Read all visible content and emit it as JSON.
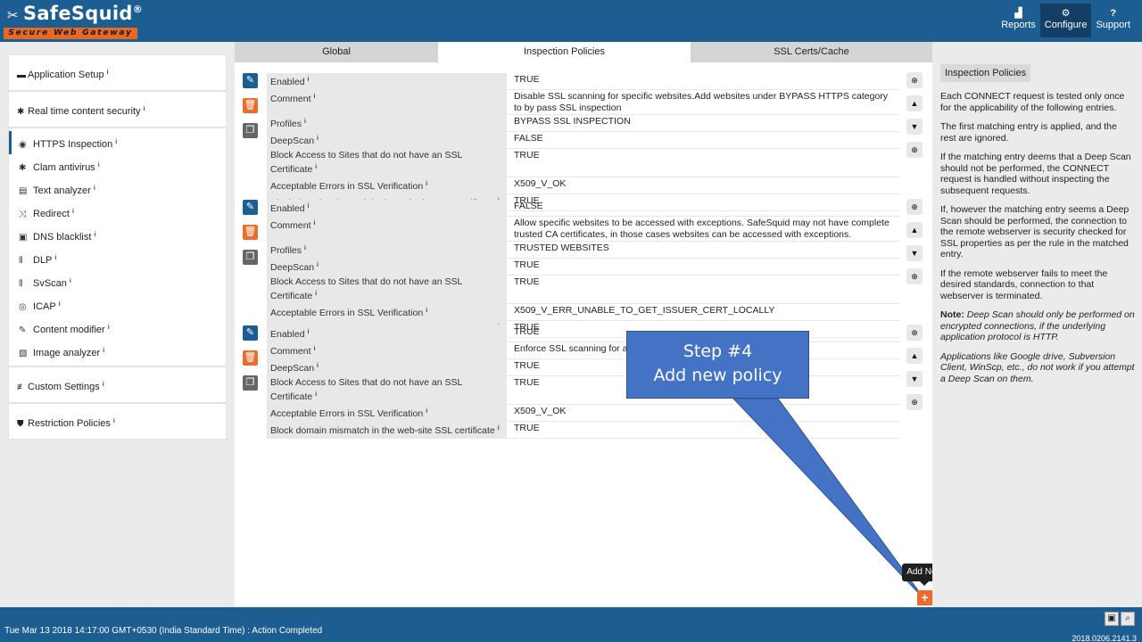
{
  "header": {
    "logo_text": "SafeSquid",
    "logo_reg": "®",
    "logo_sub": "Secure Web Gateway",
    "nav": [
      {
        "label": "Reports",
        "icon": "bar-chart-icon"
      },
      {
        "label": "Configure",
        "icon": "cogs-icon"
      },
      {
        "label": "Support",
        "icon": "question-icon"
      }
    ]
  },
  "sidebar": {
    "sections": [
      {
        "label": "Application Setup",
        "icon": "server-icon"
      },
      {
        "label": "Real time content security",
        "icon": "bug-icon"
      }
    ],
    "items": [
      {
        "label": "HTTPS Inspection",
        "icon": "eye-icon"
      },
      {
        "label": "Clam antivirus",
        "icon": "asterisk-icon"
      },
      {
        "label": "Text analyzer",
        "icon": "document-icon"
      },
      {
        "label": "Redirect",
        "icon": "shuffle-icon"
      },
      {
        "label": "DNS blacklist",
        "icon": "hdd-icon"
      },
      {
        "label": "DLP",
        "icon": "barcode-icon"
      },
      {
        "label": "SvScan",
        "icon": "barcode-icon"
      },
      {
        "label": "ICAP",
        "icon": "globe-icon"
      },
      {
        "label": "Content modifier",
        "icon": "edit-icon"
      },
      {
        "label": "Image analyzer",
        "icon": "image-icon"
      }
    ],
    "bottom": [
      {
        "label": "Custom Settings",
        "icon": "sliders-icon"
      },
      {
        "label": "Restriction Policies",
        "icon": "shield-icon"
      }
    ]
  },
  "tabs": [
    "Global",
    "Inspection Policies",
    "SSL Certs/Cache"
  ],
  "policies": [
    {
      "rows": [
        {
          "k": "Enabled",
          "v": "TRUE"
        },
        {
          "k": "Comment",
          "v": "Disable SSL scanning for specific websites.Add websites under BYPASS HTTPS category to by pass SSL inspection"
        },
        {
          "k": "Profiles",
          "v": "BYPASS SSL INSPECTION"
        },
        {
          "k": "DeepScan",
          "v": "FALSE"
        },
        {
          "k": "Block Access to Sites that do not have an SSL Certificate",
          "v": "TRUE"
        },
        {
          "k": "Acceptable Errors in SSL Verification",
          "v": "X509_V_OK"
        },
        {
          "k": "Block domain mismatch in the web-site SSL certificate",
          "v": "TRUE"
        }
      ]
    },
    {
      "rows": [
        {
          "k": "Enabled",
          "v": "FALSE"
        },
        {
          "k": "Comment",
          "v": "Allow specific websites to be accessed with exceptions. SafeSquid may not have complete trusted CA certificates, in those cases websites can be accessed with exceptions."
        },
        {
          "k": "Profiles",
          "v": "TRUSTED WEBSITES"
        },
        {
          "k": "DeepScan",
          "v": "TRUE"
        },
        {
          "k": "Block Access to Sites that do not have an SSL Certificate",
          "v": "TRUE"
        },
        {
          "k": "Acceptable Errors in SSL Verification",
          "v": "X509_V_ERR_UNABLE_TO_GET_ISSUER_CERT_LOCALLY"
        },
        {
          "k": "Block domain mismatch in the web-site SSL certificate",
          "v": "TRUE"
        }
      ]
    },
    {
      "rows": [
        {
          "k": "Enabled",
          "v": "TRUE"
        },
        {
          "k": "Comment",
          "v": "Enforce SSL scanning for all"
        },
        {
          "k": "DeepScan",
          "v": "TRUE"
        },
        {
          "k": "Block Access to Sites that do not have an SSL Certificate",
          "v": "TRUE"
        },
        {
          "k": "Acceptable Errors in SSL Verification",
          "v": "X509_V_OK"
        },
        {
          "k": "Block domain mismatch in the web-site SSL certificate",
          "v": "TRUE"
        }
      ]
    }
  ],
  "callout": {
    "line1": "Step #4",
    "line2": "Add new policy",
    "color": "#4472c4"
  },
  "add_new": {
    "tooltip": "Add New",
    "icon": "plus-icon"
  },
  "help": {
    "title": "Inspection Policies",
    "p1": "Each CONNECT request is tested only once for the applicability of the following entries.",
    "p2": "The first matching entry is applied, and the rest are ignored.",
    "p3": "If the matching entry deems that a Deep Scan should not be performed, the CONNECT request is handled without inspecting the subsequent requests.",
    "p4": "If, however the matching entry seems a Deep Scan should be performed, the connection to the remote webserver is security checked for SSL properties as per the rule in the matched entry.",
    "p5": "If the remote webserver fails to meet the desired standards, connection to that webserver is terminated.",
    "note_label": "Note:",
    "note_text": " Deep Scan should only be performed on encrypted connections, if the underlying application protocol is HTTP.",
    "p6": "Applications like Google drive, Subversion Client, WinScp, etc., do not work if you attempt a Deep Scan on them."
  },
  "footer": {
    "status": "Tue Mar 13 2018 14:17:00 GMT+0530 (India Standard Time) : Action Completed",
    "version": "2018.0206.2141.3"
  },
  "colors": {
    "brand": "#1c5d92",
    "accent": "#ef6b2c"
  }
}
